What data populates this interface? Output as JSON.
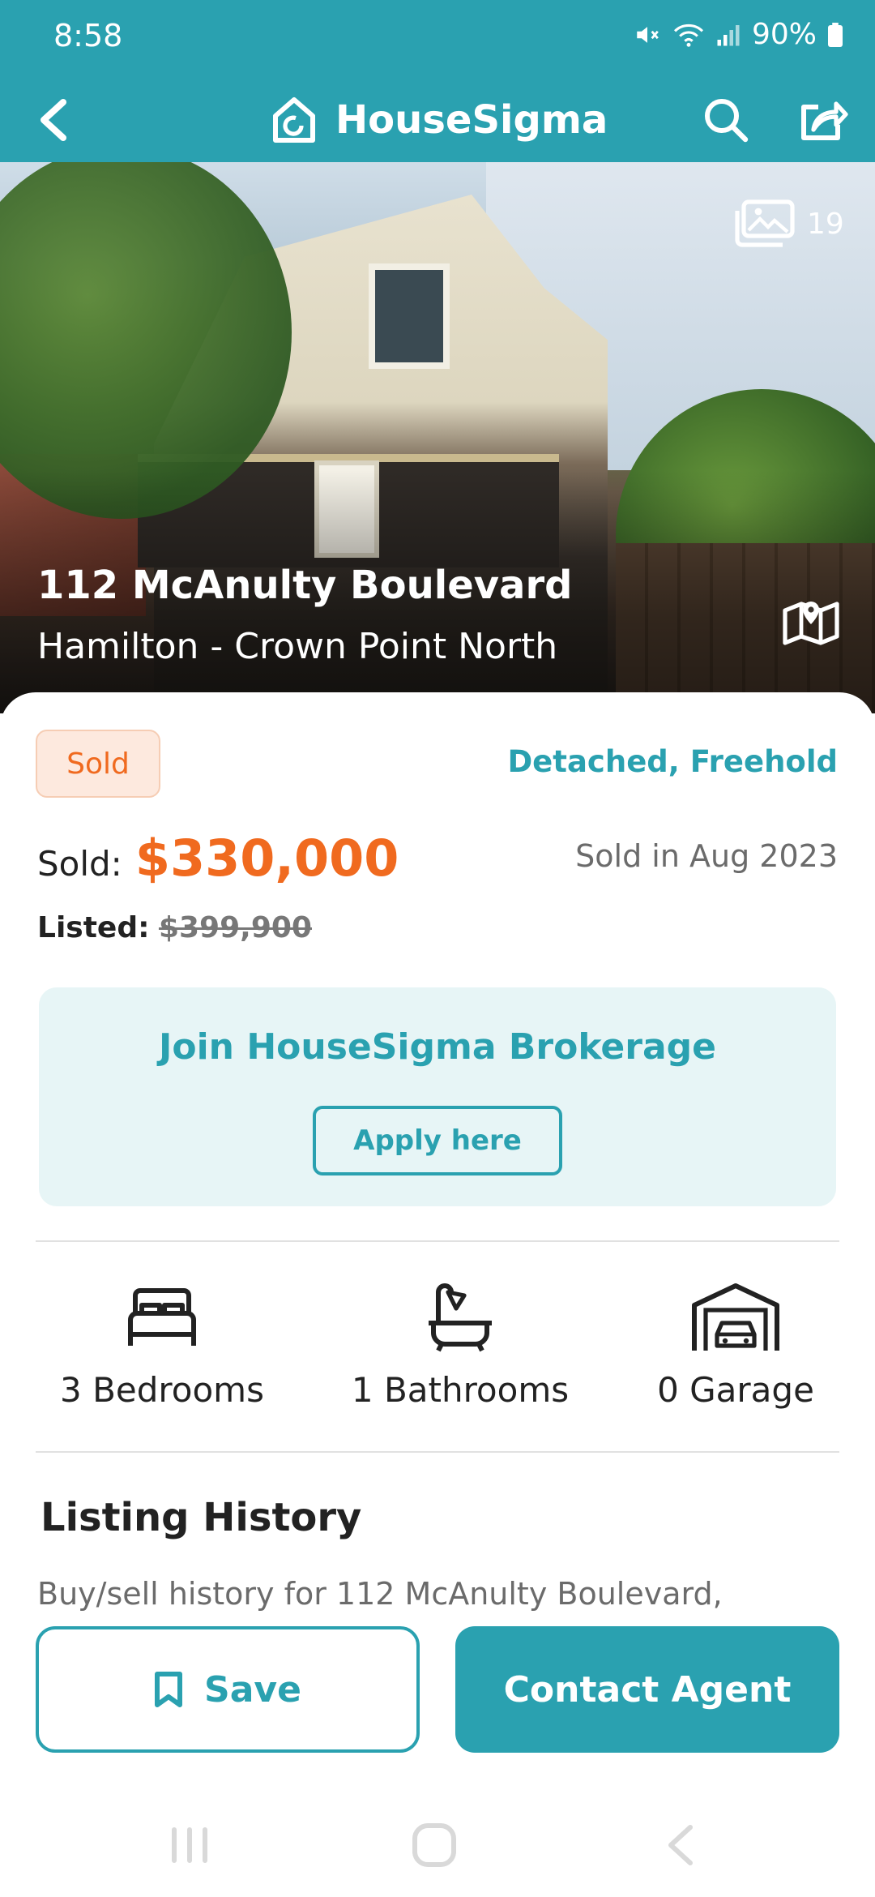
{
  "status_bar": {
    "time": "8:58",
    "battery": "90%",
    "icons": [
      "mute-icon",
      "wifi-icon",
      "signal-icon",
      "battery-icon"
    ]
  },
  "topbar": {
    "brand": "HouseSigma",
    "icons": [
      "back-icon",
      "logo-house-icon",
      "search-icon",
      "share-icon"
    ],
    "color": "#2aa1b0"
  },
  "hero": {
    "photo_count": "19",
    "address": "112 McAnulty Boulevard",
    "neighbourhood": "Hamilton - Crown Point North"
  },
  "listing": {
    "status": "Sold",
    "property_type": "Detached, Freehold",
    "sold_label": "Sold:",
    "sold_price": "$330,000",
    "sold_date": "Sold in Aug 2023",
    "listed_label": "Listed:",
    "listed_price": "$399,900",
    "accent_color": "#f06a1f"
  },
  "promo": {
    "title": "Join HouseSigma Brokerage",
    "button": "Apply here"
  },
  "features": [
    {
      "icon": "bed-icon",
      "label": "3 Bedrooms"
    },
    {
      "icon": "bathtub-icon",
      "label": "1 Bathrooms"
    },
    {
      "icon": "garage-icon",
      "label": "0 Garage"
    }
  ],
  "history": {
    "title": "Listing History",
    "description": "Buy/sell history for 112 McAnulty Boulevard,"
  },
  "actions": {
    "save": "Save",
    "contact": "Contact Agent"
  },
  "navbar": {
    "icons": [
      "recent-apps-icon",
      "home-icon",
      "back-nav-icon"
    ]
  }
}
